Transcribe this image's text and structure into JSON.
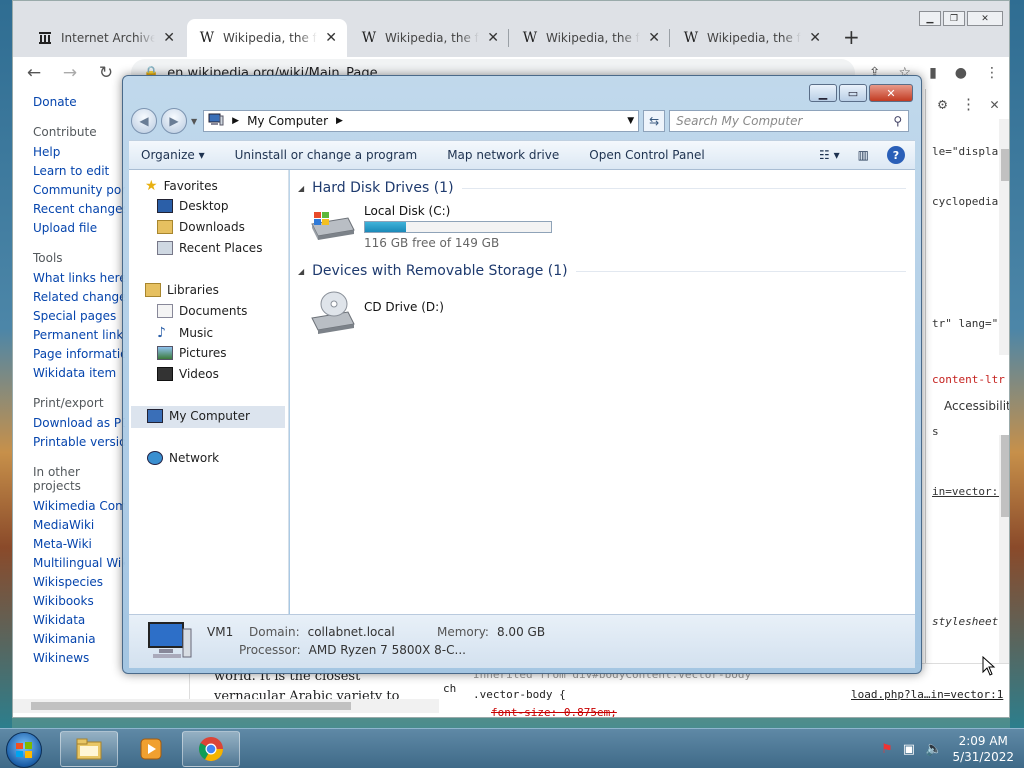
{
  "browser": {
    "tabs": [
      {
        "favicon": "archive-icon",
        "title": "Internet Archive: Digital Library",
        "active": false
      },
      {
        "favicon": "W",
        "title": "Wikipedia, the free encyclopedia",
        "active": true
      },
      {
        "favicon": "W",
        "title": "Wikipedia, the free encyclopedia",
        "active": false
      },
      {
        "favicon": "W",
        "title": "Wikipedia, the free encyclopedia",
        "active": false
      },
      {
        "favicon": "W",
        "title": "Wikipedia, the free encyclopedia",
        "active": false
      }
    ],
    "url": "en.wikipedia.org/wiki/Main_Page"
  },
  "wiki_sidebar": {
    "top_links": [
      "Donate"
    ],
    "contribute_heading": "Contribute",
    "contribute_links": [
      "Help",
      "Learn to edit",
      "Community portal",
      "Recent changes",
      "Upload file"
    ],
    "tools_heading": "Tools",
    "tools_links": [
      "What links here",
      "Related changes",
      "Special pages",
      "Permanent link",
      "Page information",
      "Wikidata item"
    ],
    "print_heading": "Print/export",
    "print_links": [
      "Download as PDF",
      "Printable version"
    ],
    "projects_heading": "In other projects",
    "projects_links": [
      "Wikimedia Commons",
      "MediaWiki",
      "Meta-Wiki",
      "Multilingual Wikisource",
      "Wikispecies",
      "Wikibooks",
      "Wikidata",
      "Wikimania",
      "Wikinews"
    ]
  },
  "wiki_body": {
    "line1": "world. It is the closest",
    "line2": "vernacular Arabic variety to"
  },
  "devtools": {
    "snippet1": "le=\"displa",
    "snippet2": "cyclopedia",
    "snippet3": "tr\" lang=\"e",
    "breadcrumb": "content-ltr",
    "accessibility_tab": "Accessibility",
    "styles_label": "s",
    "rule_source1": "in=vector:1",
    "stylesheet": "stylesheet",
    "inherited": "Inherited from div#bodyContent.vector-body",
    "selector": ".vector-body {",
    "rule_source2": "load.php?la…in=vector:1",
    "property": "font-size: 0.875em;",
    "ch": "ch"
  },
  "explorer": {
    "location": "My Computer",
    "search_placeholder": "Search My Computer",
    "commands": [
      "Organize",
      "Uninstall or change a program",
      "Map network drive",
      "Open Control Panel"
    ],
    "nav": {
      "favorites": "Favorites",
      "favorites_items": [
        "Desktop",
        "Downloads",
        "Recent Places"
      ],
      "libraries": "Libraries",
      "libraries_items": [
        "Documents",
        "Music",
        "Pictures",
        "Videos"
      ],
      "computer": "My Computer",
      "network": "Network"
    },
    "groups": {
      "hdd": "Hard Disk Drives (1)",
      "removable": "Devices with Removable Storage (1)"
    },
    "drives": {
      "local_name": "Local Disk (C:)",
      "local_free": "116 GB free of 149 GB",
      "local_used_fraction": 0.22,
      "cd_name": "CD Drive (D:)"
    },
    "details": {
      "name": "VM1",
      "domain_label": "Domain:",
      "domain": "collabnet.local",
      "memory_label": "Memory:",
      "memory": "8.00 GB",
      "processor_label": "Processor:",
      "processor": "AMD Ryzen 7 5800X 8-C..."
    }
  },
  "taskbar": {
    "time": "2:09 AM",
    "date": "5/31/2022"
  }
}
